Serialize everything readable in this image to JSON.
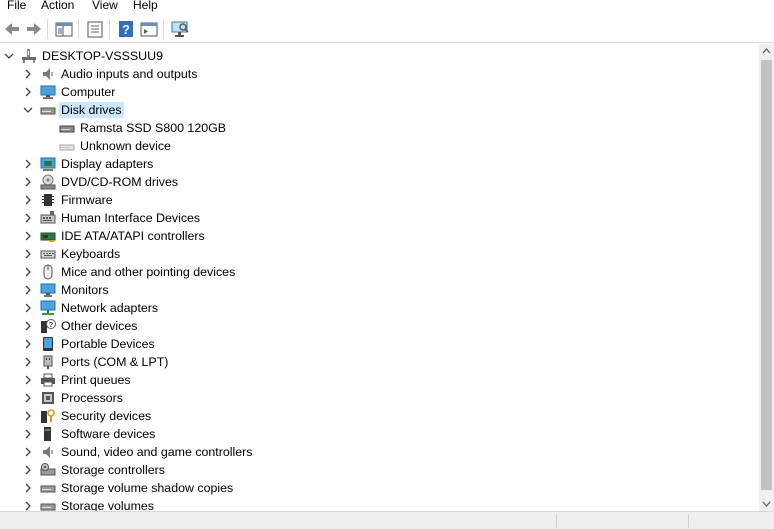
{
  "menu": {
    "items": [
      "File",
      "Action",
      "View",
      "Help"
    ]
  },
  "toolbar": {
    "buttons": [
      "back-icon",
      "forward-icon",
      "show-hide-console-tree-icon",
      "properties-icon",
      "help-icon",
      "console-tree-view-icon",
      "scan-hardware-changes-icon"
    ]
  },
  "tree": {
    "root": "DESKTOP-VSSSUU9",
    "categories": [
      {
        "label": "Audio inputs and outputs",
        "icon": "speaker-icon"
      },
      {
        "label": "Computer",
        "icon": "computer-icon"
      },
      {
        "label": "Disk drives",
        "icon": "disk-drive-icon",
        "expanded": true,
        "selected": true,
        "children": [
          {
            "label": "Ramsta SSD S800 120GB",
            "icon": "disk-drive-icon"
          },
          {
            "label": "Unknown device",
            "icon": "disk-drive-icon"
          }
        ]
      },
      {
        "label": "Display adapters",
        "icon": "display-adapter-icon"
      },
      {
        "label": "DVD/CD-ROM drives",
        "icon": "dvd-drive-icon"
      },
      {
        "label": "Firmware",
        "icon": "firmware-icon"
      },
      {
        "label": "Human Interface Devices",
        "icon": "hid-icon"
      },
      {
        "label": "IDE ATA/ATAPI controllers",
        "icon": "ide-controller-icon"
      },
      {
        "label": "Keyboards",
        "icon": "keyboard-icon"
      },
      {
        "label": "Mice and other pointing devices",
        "icon": "mouse-icon"
      },
      {
        "label": "Monitors",
        "icon": "monitor-icon"
      },
      {
        "label": "Network adapters",
        "icon": "network-adapter-icon"
      },
      {
        "label": "Other devices",
        "icon": "other-devices-icon"
      },
      {
        "label": "Portable Devices",
        "icon": "portable-device-icon"
      },
      {
        "label": "Ports (COM & LPT)",
        "icon": "port-icon"
      },
      {
        "label": "Print queues",
        "icon": "printer-icon"
      },
      {
        "label": "Processors",
        "icon": "processor-icon"
      },
      {
        "label": "Security devices",
        "icon": "security-device-icon"
      },
      {
        "label": "Software devices",
        "icon": "software-device-icon"
      },
      {
        "label": "Sound, video and game controllers",
        "icon": "sound-controller-icon"
      },
      {
        "label": "Storage controllers",
        "icon": "storage-controller-icon"
      },
      {
        "label": "Storage volume shadow copies",
        "icon": "shadow-copy-icon"
      },
      {
        "label": "Storage volumes",
        "icon": "storage-volume-icon"
      }
    ]
  },
  "colors": {
    "selection": "#cce8ff",
    "scroll_track": "#f0f0f0",
    "scroll_thumb": "#c2c2c2"
  }
}
